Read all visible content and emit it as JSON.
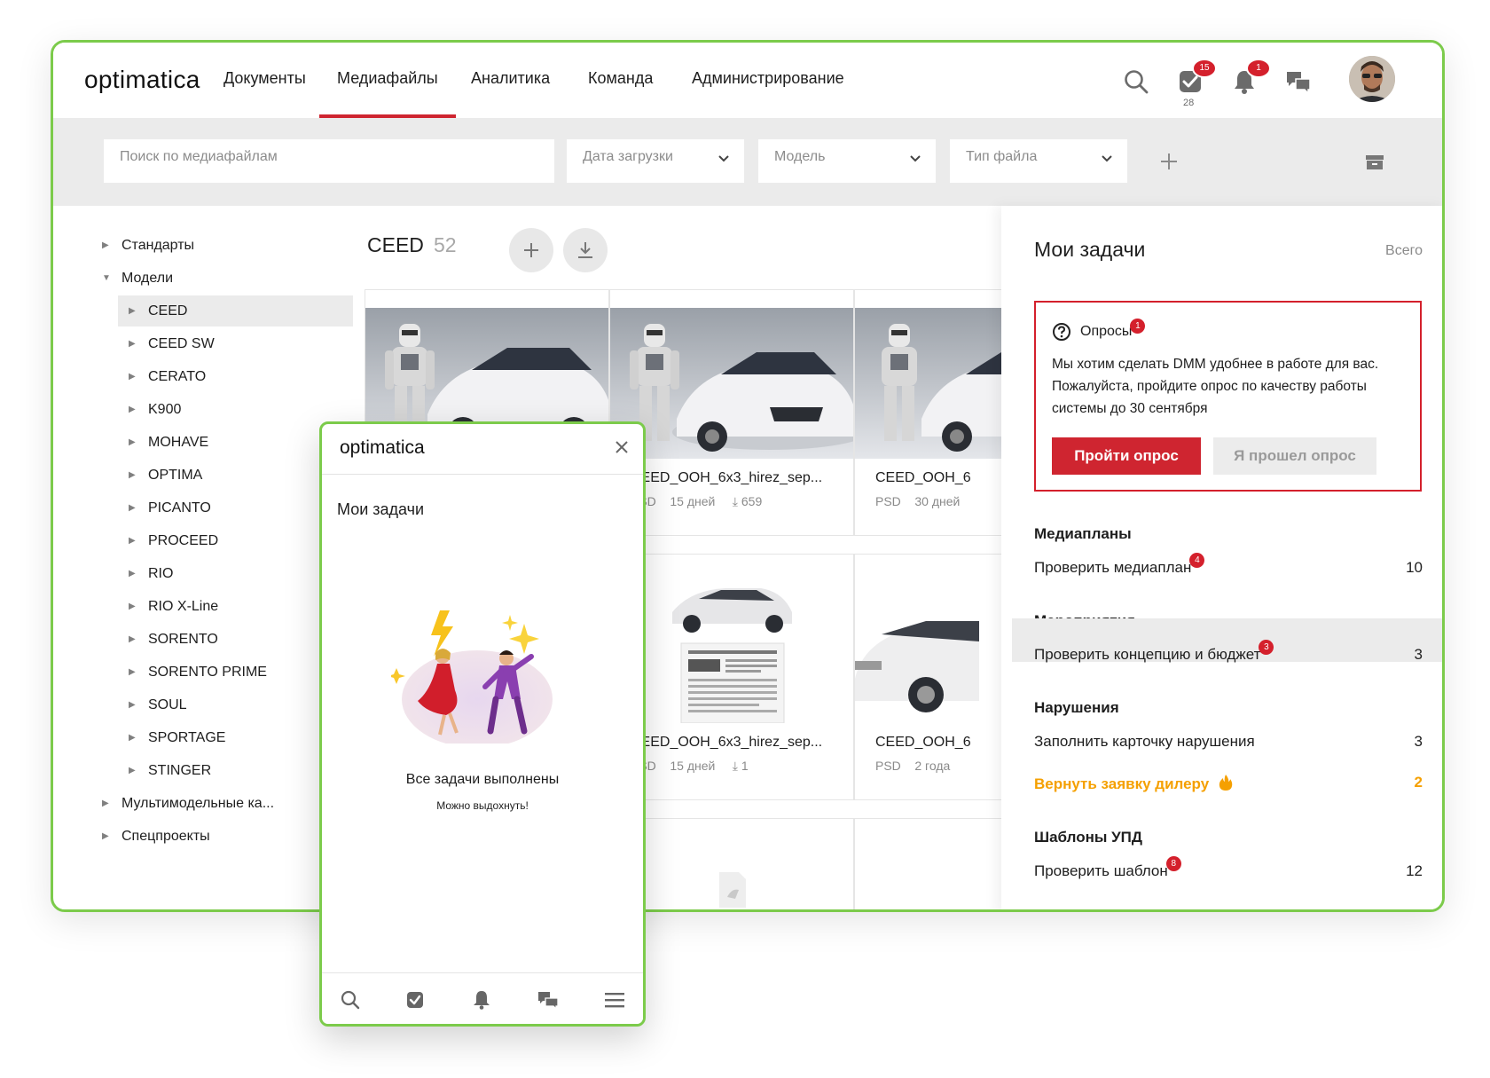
{
  "app": {
    "logo": "optimatica"
  },
  "nav": {
    "items": [
      "Документы",
      "Медиафайлы",
      "Аналитика",
      "Команда",
      "Администрирование"
    ],
    "active": "Медиафайлы"
  },
  "toolbar": {
    "tasks_badge": "15",
    "tasks_count": "28",
    "notifications_badge": "1"
  },
  "filters": {
    "search_placeholder": "Поиск по медиафайлам",
    "date": "Дата загрузки",
    "model": "Модель",
    "file_type": "Тип файла"
  },
  "tree": {
    "standards": "Стандарты",
    "models": "Модели",
    "model_items": [
      "CEED",
      "CEED SW",
      "CERATO",
      "K900",
      "MOHAVE",
      "OPTIMA",
      "PICANTO",
      "PROCEED",
      "RIO",
      "RIO X-Line",
      "SORENTO",
      "SORENTO PRIME",
      "SOUL",
      "SPORTAGE",
      "STINGER"
    ],
    "selected": "CEED",
    "multimodel": "Мультимодельные ка...",
    "special": "Спецпроекты"
  },
  "folder": {
    "title": "CEED",
    "count": "52"
  },
  "cards": [
    {
      "name": "",
      "type": "",
      "age": "",
      "downloads": ""
    },
    {
      "name": "CEED_OOH_6x3_hirez_sep...",
      "type": "PSD",
      "age": "15 дней",
      "downloads": "659"
    },
    {
      "name": "CEED_OOH_6",
      "type": "PSD",
      "age": "30 дней",
      "downloads": ""
    },
    {
      "name": "CEED_OOH_6x3_hirez_sep...",
      "type": "PSD",
      "age": "15 дней",
      "downloads": "1"
    },
    {
      "name": "CEED_OOH_6",
      "type": "PSD",
      "age": "2 года",
      "downloads": ""
    }
  ],
  "tasks_panel": {
    "title": "Мои задачи",
    "all_link": "Всего",
    "survey": {
      "label": "Опросы",
      "badge": "1",
      "text": "Мы хотим сделать DMM удобнее в работе для вас. Пожалуйста, пройдите опрос по качеству работы системы до 30 сентября",
      "primary_button": "Пройти опрос",
      "secondary_button": "Я прошел опрос"
    },
    "sections": [
      {
        "title": "Медиапланы",
        "tasks": [
          {
            "label": "Проверить медиаплан",
            "badge": "4",
            "count": "10"
          }
        ]
      },
      {
        "title": "Мероприятия",
        "tasks": [
          {
            "label": "Проверить концепцию и бюджет",
            "badge": "3",
            "count": "3"
          }
        ]
      },
      {
        "title": "Нарушения",
        "tasks": [
          {
            "label": "Заполнить карточку нарушения",
            "count": "3"
          },
          {
            "label": "Вернуть заявку дилеру",
            "count": "2"
          }
        ]
      },
      {
        "title": "Шаблоны УПД",
        "tasks": [
          {
            "label": "Проверить шаблон",
            "badge": "8",
            "count": "12"
          }
        ]
      }
    ]
  },
  "mobile": {
    "logo": "optimatica",
    "title": "Мои задачи",
    "done": "Все задачи выполнены",
    "sub": "Можно выдохнуть!"
  },
  "colors": {
    "accent": "#cf2530",
    "frame": "#7ccb4b",
    "warning": "#f5a000"
  }
}
